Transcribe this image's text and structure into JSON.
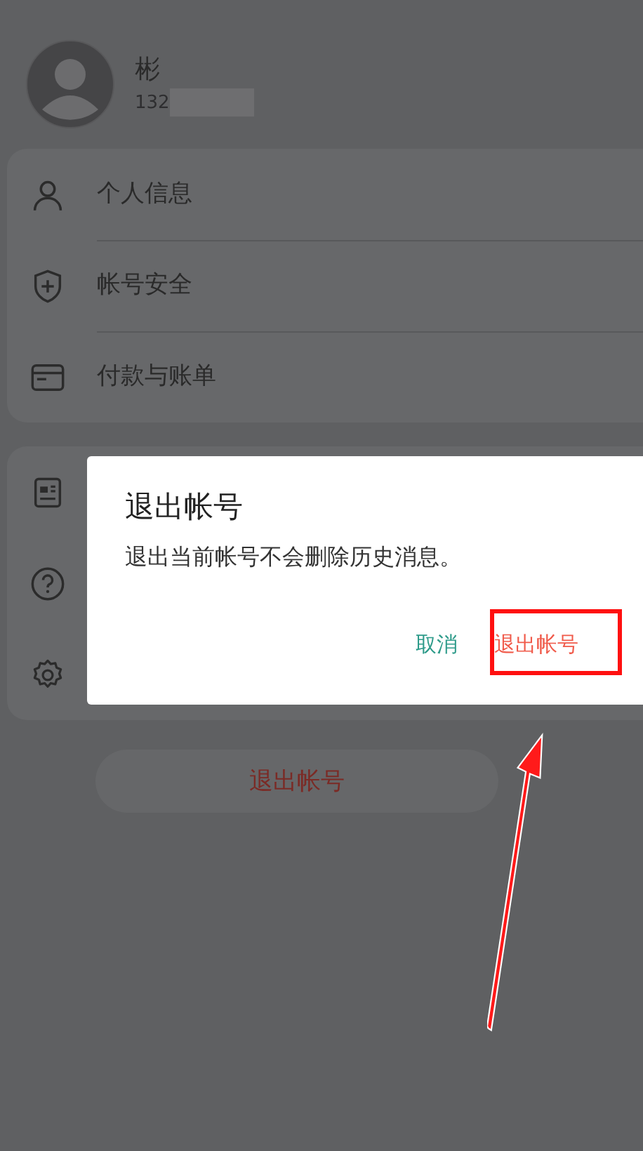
{
  "profile": {
    "name": "彬",
    "phone": "132"
  },
  "menu": [
    {
      "label": "个人信息"
    },
    {
      "label": "帐号安全"
    },
    {
      "label": "付款与账单"
    }
  ],
  "logout_button": "退出帐号",
  "dialog": {
    "title": "退出帐号",
    "message": "退出当前帐号不会删除历史消息。",
    "cancel": "取消",
    "confirm": "退出帐号"
  }
}
